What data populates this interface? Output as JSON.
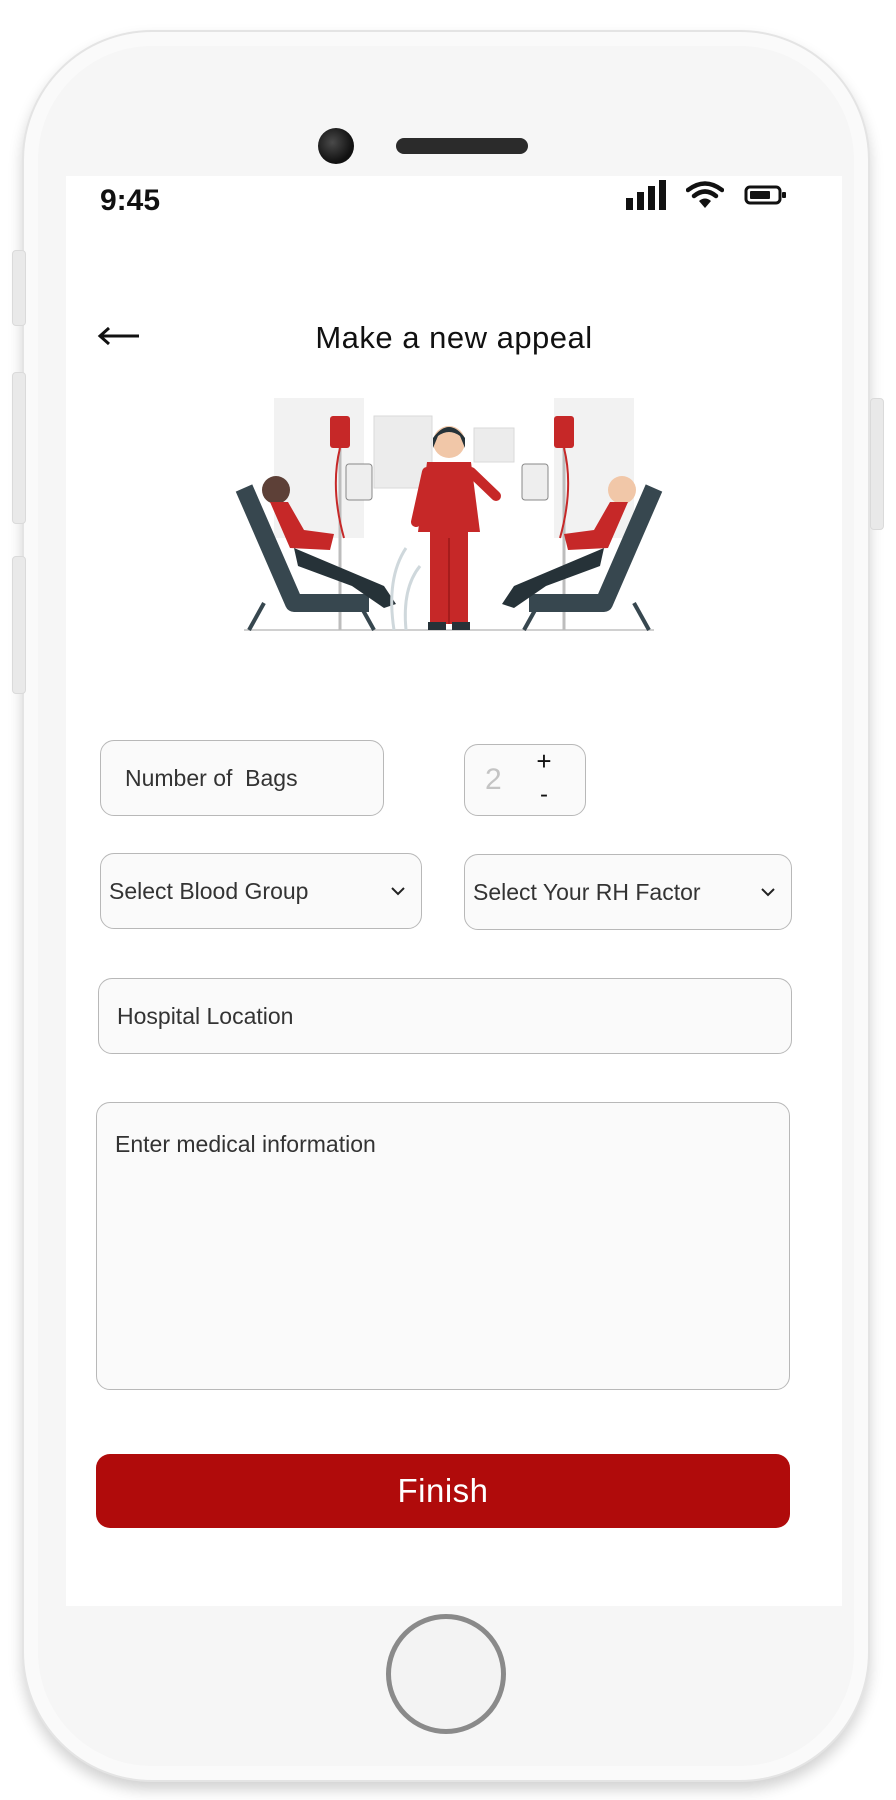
{
  "status_bar": {
    "time": "9:45"
  },
  "header": {
    "title": "Make a new appeal"
  },
  "form": {
    "bags_placeholder": "Number of  Bags",
    "bags_value": "2",
    "stepper_plus": "+",
    "stepper_minus": "-",
    "blood_group_placeholder": "Select Blood Group",
    "rh_factor_placeholder": "Select Your RH Factor",
    "hospital_placeholder": "Hospital Location",
    "medical_placeholder": "Enter medical information"
  },
  "actions": {
    "finish_label": "Finish"
  },
  "colors": {
    "accent": "#b00b0b",
    "illustration_red": "#c62828",
    "chair": "#37474f"
  }
}
